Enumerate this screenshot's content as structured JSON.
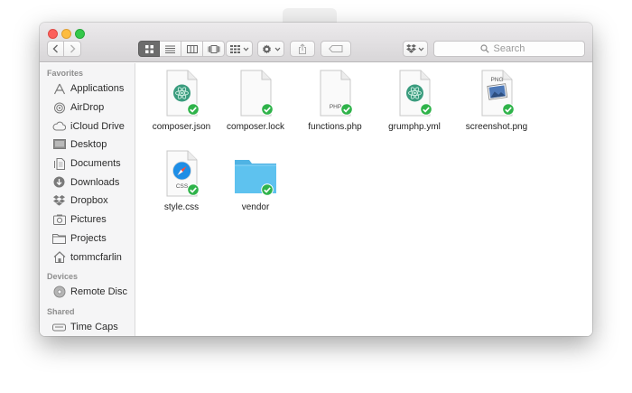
{
  "search": {
    "placeholder": "Search"
  },
  "sidebar": {
    "sections": [
      {
        "title": "Favorites",
        "items": [
          {
            "label": "Applications",
            "icon": "applications-icon"
          },
          {
            "label": "AirDrop",
            "icon": "airdrop-icon"
          },
          {
            "label": "iCloud Drive",
            "icon": "icloud-icon"
          },
          {
            "label": "Desktop",
            "icon": "desktop-icon"
          },
          {
            "label": "Documents",
            "icon": "documents-icon"
          },
          {
            "label": "Downloads",
            "icon": "downloads-icon"
          },
          {
            "label": "Dropbox",
            "icon": "dropbox-icon"
          },
          {
            "label": "Pictures",
            "icon": "pictures-icon"
          },
          {
            "label": "Projects",
            "icon": "folder-icon"
          },
          {
            "label": "tommcfarlin",
            "icon": "home-icon"
          }
        ]
      },
      {
        "title": "Devices",
        "items": [
          {
            "label": "Remote Disc",
            "icon": "disc-icon"
          }
        ]
      },
      {
        "title": "Shared",
        "items": [
          {
            "label": "Time Caps",
            "icon": "time-capsule-icon"
          }
        ]
      }
    ]
  },
  "files": [
    {
      "name": "composer.json",
      "type": "atom-doc",
      "tag": ""
    },
    {
      "name": "composer.lock",
      "type": "blank-doc",
      "tag": ""
    },
    {
      "name": "functions.php",
      "type": "tag-doc",
      "tag": "PHP"
    },
    {
      "name": "grumphp.yml",
      "type": "atom-doc",
      "tag": ""
    },
    {
      "name": "screenshot.png",
      "type": "image-doc",
      "tag": "PNG"
    },
    {
      "name": "style.css",
      "type": "safari-doc",
      "tag": "CSS"
    },
    {
      "name": "vendor",
      "type": "folder",
      "tag": ""
    }
  ],
  "colors": {
    "sync_check": "#2fb34a",
    "folder": "#5ec2ef",
    "atom": "#3a9c7e",
    "safari": "#1e8ee6"
  }
}
